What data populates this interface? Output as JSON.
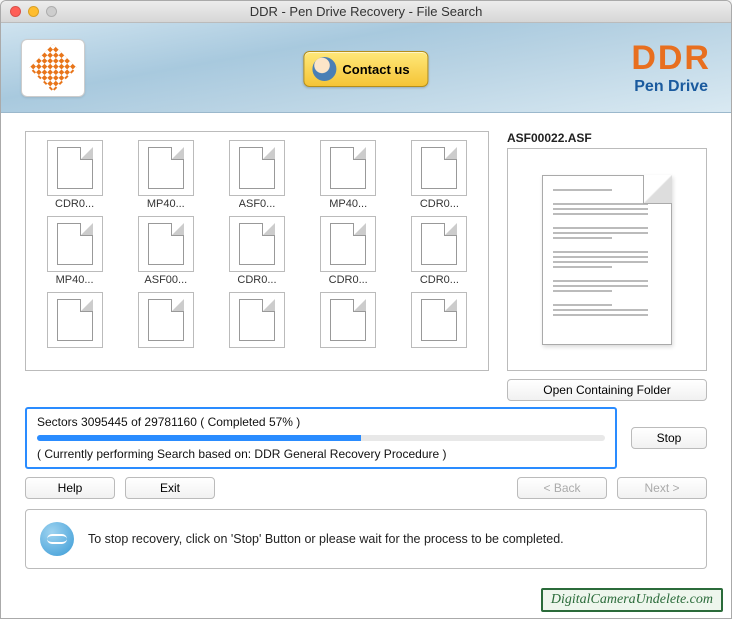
{
  "window": {
    "title": "DDR - Pen Drive Recovery - File Search"
  },
  "header": {
    "contact_label": "Contact us",
    "brand_name": "DDR",
    "brand_sub": "Pen Drive"
  },
  "files": [
    {
      "name": "CDR0..."
    },
    {
      "name": "MP40..."
    },
    {
      "name": "ASF0..."
    },
    {
      "name": "MP40..."
    },
    {
      "name": "CDR0..."
    },
    {
      "name": "MP40..."
    },
    {
      "name": "ASF00..."
    },
    {
      "name": "CDR0..."
    },
    {
      "name": "CDR0..."
    },
    {
      "name": "CDR0..."
    },
    {
      "name": ""
    },
    {
      "name": ""
    },
    {
      "name": ""
    },
    {
      "name": ""
    },
    {
      "name": ""
    }
  ],
  "preview": {
    "filename": "ASF00022.ASF"
  },
  "buttons": {
    "open_folder": "Open Containing Folder",
    "stop": "Stop",
    "help": "Help",
    "exit": "Exit",
    "back": "< Back",
    "next": "Next >"
  },
  "progress": {
    "sectors_current": "3095445",
    "sectors_total": "29781160",
    "percent": 57,
    "line1": "Sectors 3095445 of 29781160   ( Completed 57% )",
    "line2": "( Currently performing Search based on: DDR General Recovery Procedure )"
  },
  "info": {
    "text": "To stop recovery, click on 'Stop' Button or please wait for the process to be completed."
  },
  "watermark": "DigitalCameraUndelete.com",
  "colors": {
    "accent": "#2a8cff",
    "brand_orange": "#e86f1f",
    "brand_blue": "#1a5a9e"
  }
}
